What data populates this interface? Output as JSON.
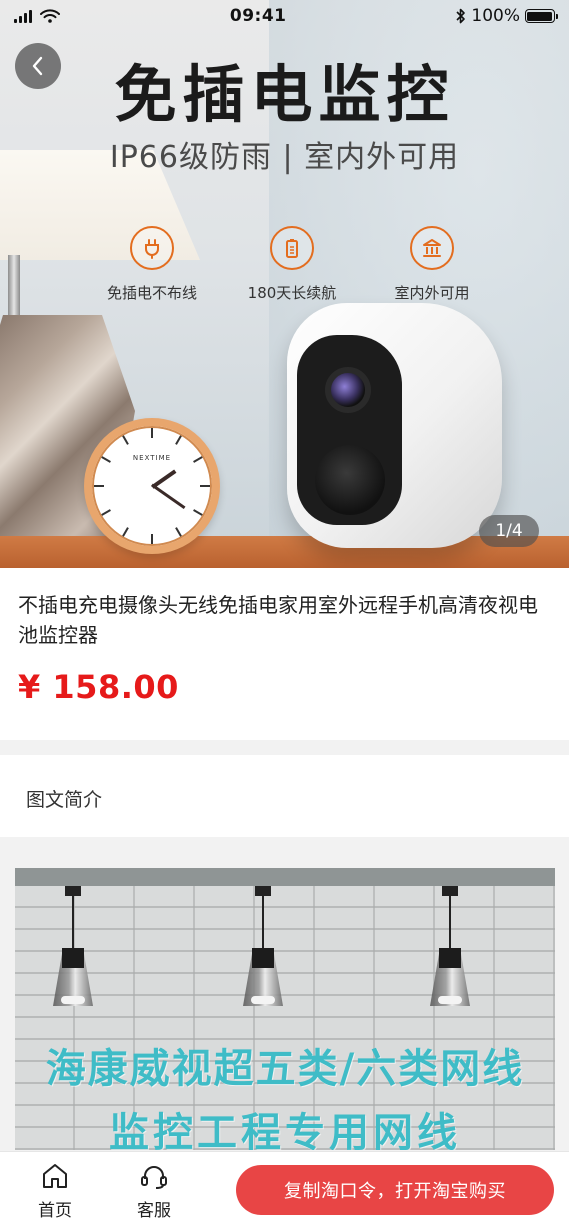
{
  "status_bar": {
    "time": "09:41",
    "battery": "100%"
  },
  "hero": {
    "title": "免插电监控",
    "subtitle": "IP66级防雨 | 室内外可用",
    "features": [
      {
        "icon": "plug-icon",
        "label": "免插电不布线"
      },
      {
        "icon": "battery-icon",
        "label": "180天长续航"
      },
      {
        "icon": "building-icon",
        "label": "室内外可用"
      }
    ],
    "clock_brand": "NEXTIME",
    "page_indicator": "1/4"
  },
  "product": {
    "title": "不插电充电摄像头无线免插电家用室外远程手机高清夜视电池监控器",
    "price": "¥ 158.00"
  },
  "section": {
    "title": "图文简介"
  },
  "detail_image": {
    "line1": "海康威视超五类/六类网线",
    "line2": "监控工程专用网线"
  },
  "bottom_bar": {
    "home_label": "首页",
    "service_label": "客服",
    "buy_label": "复制淘口令，打开淘宝购买"
  },
  "colors": {
    "accent": "#e84545",
    "price": "#e61a1a",
    "feature_orange": "#e36d1f",
    "detail_text": "#3fbcc7"
  }
}
